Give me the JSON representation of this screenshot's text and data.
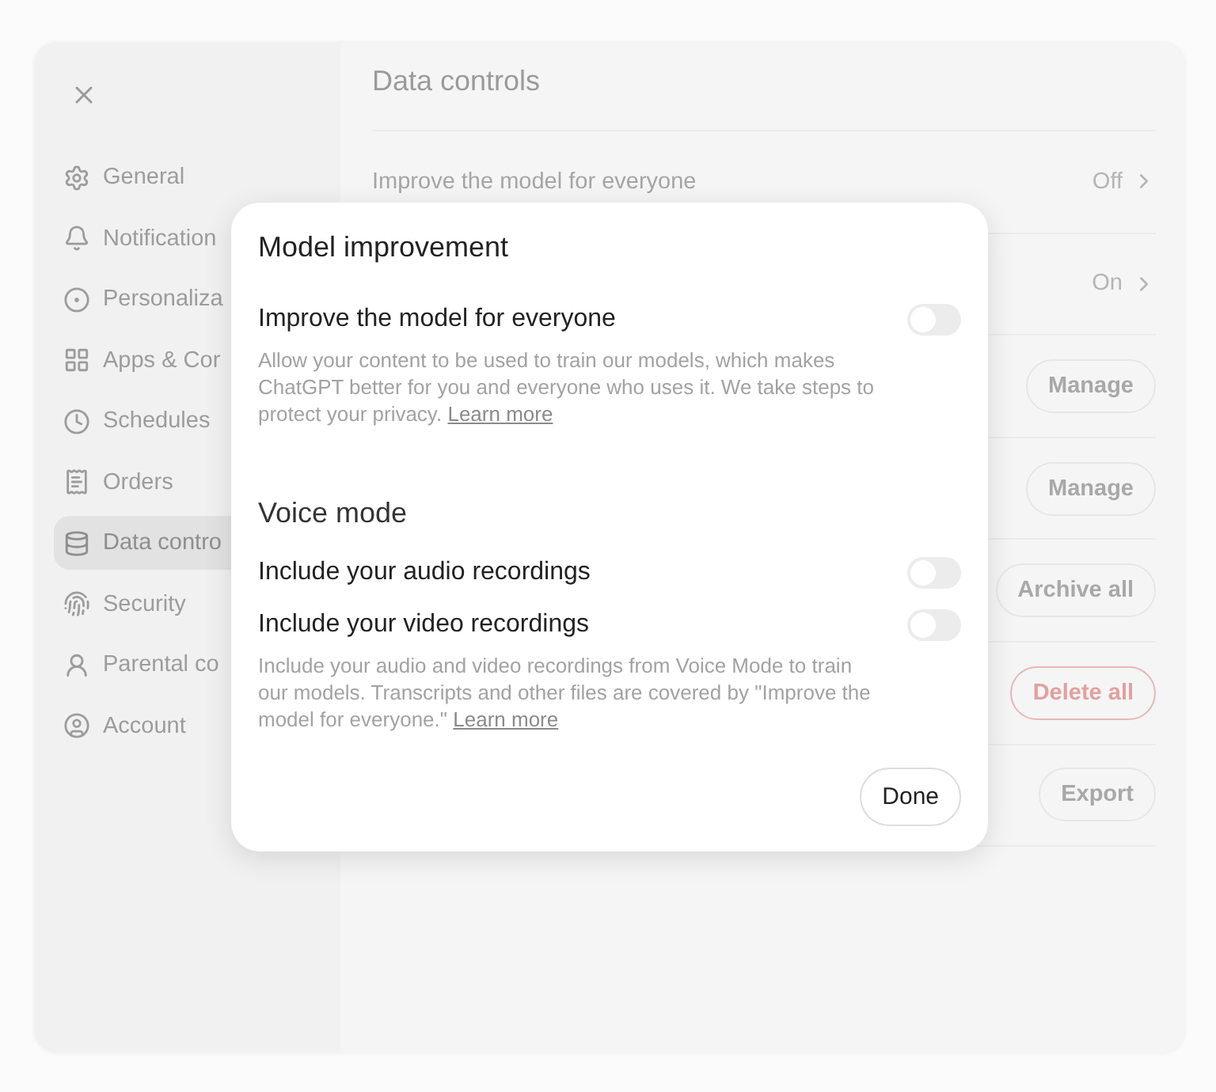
{
  "sidebar": {
    "items": [
      {
        "label": "General",
        "selected": false
      },
      {
        "label": "Notification",
        "selected": false
      },
      {
        "label": "Personaliza",
        "selected": false
      },
      {
        "label": "Apps & Cor",
        "selected": false
      },
      {
        "label": "Schedules",
        "selected": false
      },
      {
        "label": "Orders",
        "selected": false
      },
      {
        "label": "Data contro",
        "selected": true
      },
      {
        "label": "Security",
        "selected": false
      },
      {
        "label": "Parental co",
        "selected": false
      },
      {
        "label": "Account",
        "selected": false
      }
    ]
  },
  "content": {
    "title": "Data controls",
    "rows": [
      {
        "kind": "link",
        "label": "Improve the model for everyone",
        "value": "Off"
      },
      {
        "kind": "link",
        "value": "On"
      },
      {
        "kind": "button",
        "button": "Manage",
        "danger": false
      },
      {
        "kind": "button",
        "button": "Manage",
        "danger": false
      },
      {
        "kind": "button",
        "button": "Archive all",
        "danger": false
      },
      {
        "kind": "button",
        "button": "Delete all",
        "danger": true
      },
      {
        "kind": "button",
        "button": "Export",
        "danger": false
      }
    ]
  },
  "dialog": {
    "title": "Model improvement",
    "settings": [
      {
        "label": "Improve the model for everyone",
        "on": false
      }
    ],
    "description": {
      "text": "Allow your content to be used to train our models, which makes ChatGPT better for you and everyone who uses it. We take steps to protect your privacy.",
      "link": "Learn more"
    },
    "section": {
      "title": "Voice mode",
      "settings": [
        {
          "label": "Include your audio recordings",
          "on": false
        },
        {
          "label": "Include your video recordings",
          "on": false
        }
      ],
      "description": {
        "text": "Include your audio and video recordings from Voice Mode to train our models. Transcripts and other files are covered by \"Improve the model for everyone.\"",
        "link": "Learn more"
      }
    },
    "done_button": "Done"
  }
}
